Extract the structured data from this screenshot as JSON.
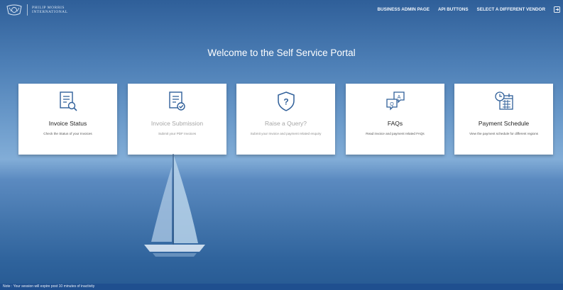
{
  "header": {
    "logo_line1": "PHILIP MORRIS",
    "logo_line2": "INTERNATIONAL",
    "nav": {
      "business_admin": "BUSINESS ADMIN PAGE",
      "api_buttons": "API BUTTONS",
      "select_vendor": "SELECT A DIFFERENT VENDOR"
    }
  },
  "main": {
    "title": "Welcome to the Self Service Portal",
    "cards": [
      {
        "title": "Invoice Status",
        "desc": "Check the Status of your Invoices",
        "icon": "invoice-search-icon",
        "enabled": true
      },
      {
        "title": "Invoice Submission",
        "desc": "Submit your PDF Invoices",
        "icon": "invoice-check-icon",
        "enabled": false
      },
      {
        "title": "Raise a Query?",
        "desc": "Submit your Invoice and payment related enquiry",
        "icon": "shield-question-icon",
        "enabled": false
      },
      {
        "title": "FAQs",
        "desc": "Read invoice and payment related FAQs",
        "icon": "qa-chat-icon",
        "enabled": true
      },
      {
        "title": "Payment Schedule",
        "desc": "View the payment schedule for different regions",
        "icon": "calendar-clock-icon",
        "enabled": true
      }
    ]
  },
  "footer": {
    "note": "Note : Your session will expire post 10 minutes of inactivity"
  },
  "colors": {
    "icon_blue": "#2f5f99",
    "footer_bg": "#1f4f8f"
  }
}
